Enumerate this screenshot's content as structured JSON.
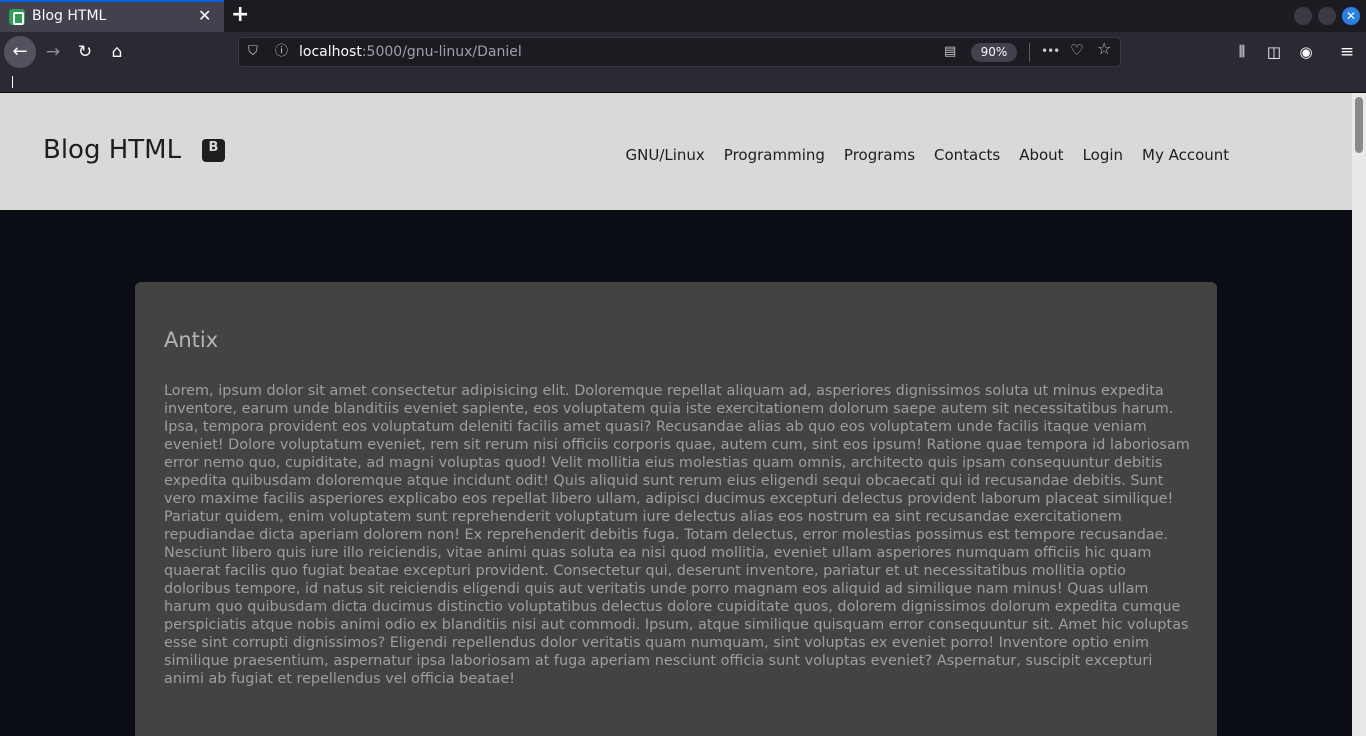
{
  "browser": {
    "tab_title": "Blog HTML",
    "tab_close": "✕",
    "new_tab": "+",
    "win_close": "✕",
    "url_host": "localhost",
    "url_path": ":5000/gnu-linux/Daniel",
    "zoom": "90%",
    "more": "•••"
  },
  "site": {
    "brand": "Blog HTML",
    "menu": [
      "GNU/Linux",
      "Programming",
      "Programs",
      "Contacts",
      "About",
      "Login",
      "My Account"
    ]
  },
  "post": {
    "title": "Antix",
    "body": "Lorem, ipsum dolor sit amet consectetur adipisicing elit. Doloremque repellat aliquam ad, asperiores dignissimos soluta ut minus expedita inventore, earum unde blanditiis eveniet sapiente, eos voluptatem quia iste exercitationem dolorum saepe autem sit necessitatibus harum. Ipsa, tempora provident eos voluptatum deleniti facilis amet quasi? Recusandae alias ab quo eos voluptatem unde facilis itaque veniam eveniet! Dolore voluptatum eveniet, rem sit rerum nisi officiis corporis quae, autem cum, sint eos ipsum! Ratione quae tempora id laboriosam error nemo quo, cupiditate, ad magni voluptas quod! Velit mollitia eius molestias quam omnis, architecto quis ipsam consequuntur debitis expedita quibusdam doloremque atque incidunt odit! Quis aliquid sunt rerum eius eligendi sequi obcaecati qui id recusandae debitis. Sunt vero maxime facilis asperiores explicabo eos repellat libero ullam, adipisci ducimus excepturi delectus provident laborum placeat similique! Pariatur quidem, enim voluptatem sunt reprehenderit voluptatum iure delectus alias eos nostrum ea sint recusandae exercitationem repudiandae dicta aperiam dolorem non! Ex reprehenderit debitis fuga. Totam delectus, error molestias possimus est tempore recusandae. Nesciunt libero quis iure illo reiciendis, vitae animi quas soluta ea nisi quod mollitia, eveniet ullam asperiores numquam officiis hic quam quaerat facilis quo fugiat beatae excepturi provident. Consectetur qui, deserunt inventore, pariatur et ut necessitatibus mollitia optio doloribus tempore, id natus sit reiciendis eligendi quis aut veritatis unde porro magnam eos aliquid ad similique nam minus! Quas ullam harum quo quibusdam dicta ducimus distinctio voluptatibus delectus dolore cupiditate quos, dolorem dignissimos dolorum expedita cumque perspiciatis atque nobis animi odio ex blanditiis nisi aut commodi. Ipsum, atque similique quisquam error consequuntur sit. Amet hic voluptas esse sint corrupti dignissimos? Eligendi repellendus dolor veritatis quam numquam, sint voluptas ex eveniet porro! Inventore optio enim similique praesentium, aspernatur ipsa laboriosam at fuga aperiam nesciunt officia sunt voluptas eveniet? Aspernatur, suscipit excepturi animi ab fugiat et repellendus vel officia beatae!"
  }
}
